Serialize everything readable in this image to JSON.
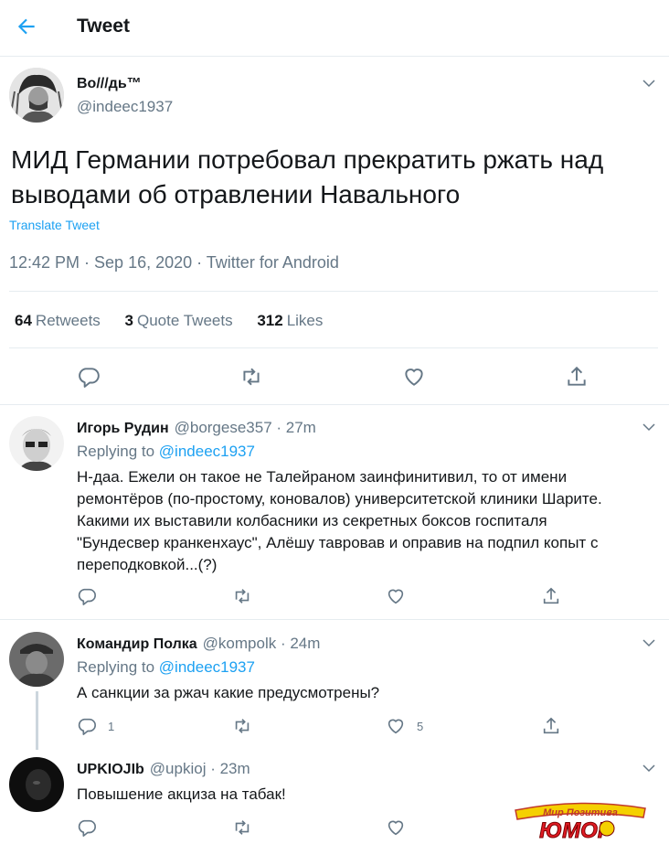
{
  "header": {
    "title": "Tweet"
  },
  "main_tweet": {
    "author_name": "Во///дь™",
    "author_handle": "@indeec1937",
    "text": "МИД Германии потребовал прекратить ржать над выводами об отравлении Навального",
    "translate_label": "Translate Tweet",
    "meta": "12:42 PM · Sep 16, 2020 · Twitter for Android",
    "stats": {
      "retweets_count": "64",
      "retweets_label": "Retweets",
      "quotes_count": "3",
      "quotes_label": "Quote Tweets",
      "likes_count": "312",
      "likes_label": "Likes"
    }
  },
  "replies": [
    {
      "name": "Игорь Рудин",
      "handle_time": "@borgese357 · 27m",
      "replying_prefix": "Replying to",
      "replying_to": "@indeec1937",
      "text": "Н-даа. Ежели он такое не Талейраном заинфинитивил, то от имени ремонтёров (по-простому, коновалов) университетской клиники Шарите. Какими их выставили колбасники из секретных боксов госпиталя \"Бундесвер кранкенхаус\", Алёшу тавровав и оправив на подпил копыт с переподковкой...(?)"
    },
    {
      "name": "Командир Полка",
      "handle_time": "@kompolk · 24m",
      "replying_prefix": "Replying to",
      "replying_to": "@indeec1937",
      "text": "А санкции за ржач какие предусмотрены?",
      "reply_count": "1",
      "like_count": "5"
    },
    {
      "name": "UPKIOJIb",
      "handle_time": "@upkioj · 23m",
      "text": "Повышение акциза на табак!"
    }
  ],
  "watermark": {
    "line1": "Мир Позитива",
    "line2": "ЮМОР"
  },
  "colors": {
    "accent": "#1da1f2",
    "muted": "#657786",
    "border": "#e6ecf0",
    "text": "#14171a"
  },
  "icons": [
    "back-arrow-icon",
    "chevron-down-icon",
    "reply-icon",
    "retweet-icon",
    "like-icon",
    "share-icon"
  ]
}
